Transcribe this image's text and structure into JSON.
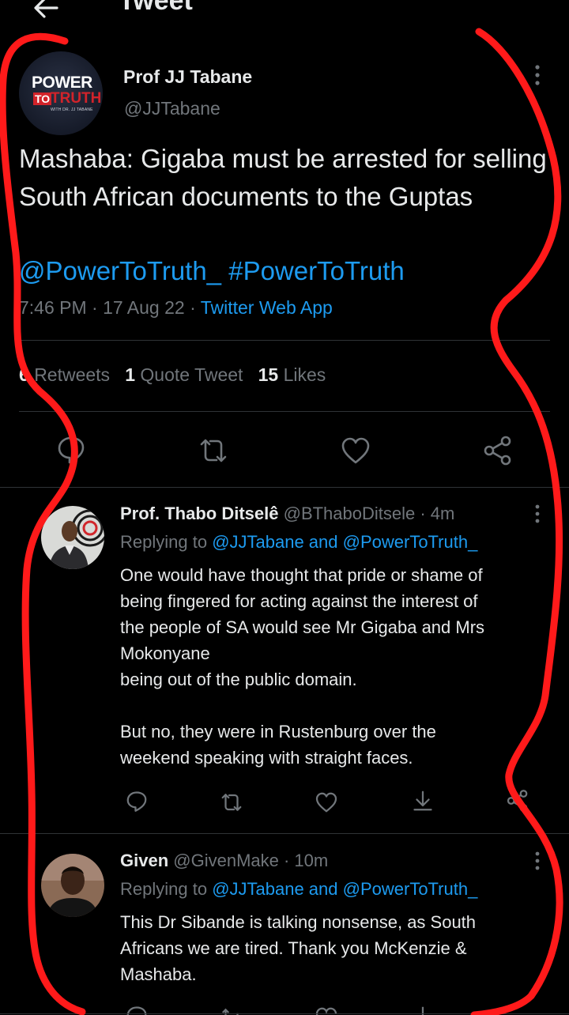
{
  "header": {
    "title": "Tweet",
    "back_icon": "arrow-left-icon"
  },
  "main_tweet": {
    "avatar_logo": {
      "line1": "POWER",
      "to": "TO",
      "truth": "TRUTH",
      "with": "WITH DR. JJ TABANE"
    },
    "author_name": "Prof JJ Tabane",
    "author_handle": "@JJTabane",
    "text": "Mashaba: Gigaba must be arrested for selling South African documents to the Guptas",
    "mention": "@PowerToTruth_",
    "hashtag": "#PowerToTruth",
    "time": "7:46 PM · 17 Aug 22 · ",
    "source": "Twitter Web App",
    "stats": {
      "retweets_count": "6",
      "retweets_label": "Retweets",
      "quotes_count": "1",
      "quotes_label": "Quote Tweet",
      "likes_count": "15",
      "likes_label": "Likes"
    }
  },
  "replies": [
    {
      "name": "Prof. Thabo Ditselê",
      "handle": "@BThaboDitsele",
      "time": " · 4m",
      "replying_prefix": "Replying to ",
      "replying_targets": "@JJTabane and @PowerToTruth_",
      "text": "One would have thought that pride or shame of\nbeing fingered for acting against the interest of\nthe people of SA would see Mr Gigaba and Mrs\nMokonyane\nbeing out of the public domain.\n\nBut no, they were in Rustenburg over the\nweekend speaking with straight faces."
    },
    {
      "name": "Given",
      "handle": "@GivenMake",
      "time": " · 10m",
      "replying_prefix": "Replying to ",
      "replying_targets": "@JJTabane and @PowerToTruth_",
      "text": "This Dr Sibande is talking nonsense, as South\nAfricans we are tired. Thank you McKenzie &\nMashaba."
    }
  ],
  "colors": {
    "background": "#000000",
    "text": "#e7e9ea",
    "muted": "#71767b",
    "link": "#1d9bf0",
    "annotation": "#ff1a1a"
  }
}
